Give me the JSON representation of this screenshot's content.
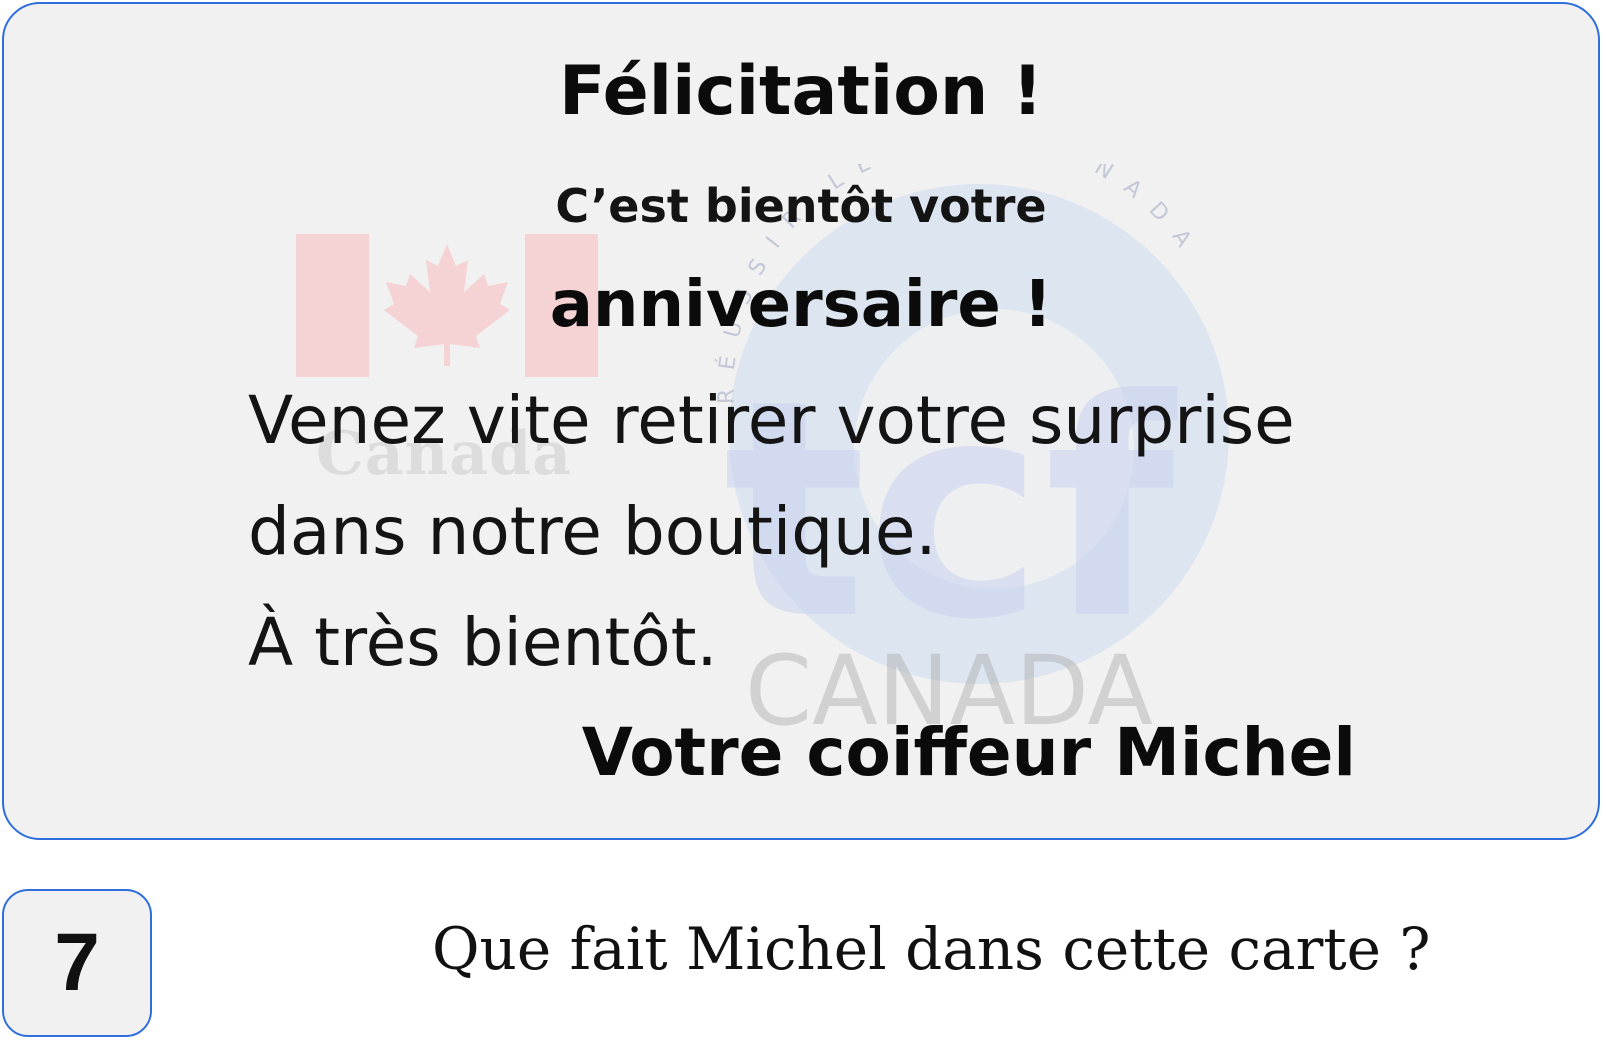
{
  "card": {
    "title": "Félicitation !",
    "subtitle_line1": "C’est bientôt votre",
    "subtitle_line2": "anniversaire !",
    "body_lines": [
      "Venez vite retirer votre surprise",
      "dans notre boutique.",
      "À très bientôt."
    ],
    "signature": "Votre coiffeur Michel",
    "watermark": {
      "canada_word": "Canada",
      "logo_text": "tcf",
      "logo_bottom": "CANADA",
      "logo_ring": "RÉUSSIR LE TCF CANADA"
    }
  },
  "question": {
    "number": "7",
    "text": "Que fait Michel dans cette carte ?"
  },
  "colors": {
    "border_blue": "#2f6fdc",
    "card_bg": "#f1f1f1",
    "text": "#111111"
  }
}
